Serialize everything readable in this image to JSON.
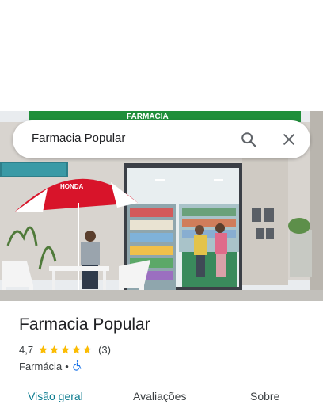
{
  "search": {
    "value": "Farmacia Popular",
    "search_icon": "search-icon",
    "close_icon": "close-icon"
  },
  "photo": {
    "sign_text": "FARMACIA",
    "umbrella_text": "HONDA"
  },
  "place": {
    "title": "Farmacia Popular",
    "rating": "4,7",
    "stars": 4.7,
    "review_count": "(3)",
    "category": "Farmácia",
    "separator": "•",
    "accessibility_icon": "wheelchair-icon"
  },
  "colors": {
    "star": "#fbbc04",
    "accent": "#0b7b8f",
    "accessibility": "#1a73e8"
  },
  "tabs": [
    {
      "label": "Visão geral",
      "active": true
    },
    {
      "label": "Avaliações",
      "active": false
    },
    {
      "label": "Sobre",
      "active": false
    }
  ]
}
